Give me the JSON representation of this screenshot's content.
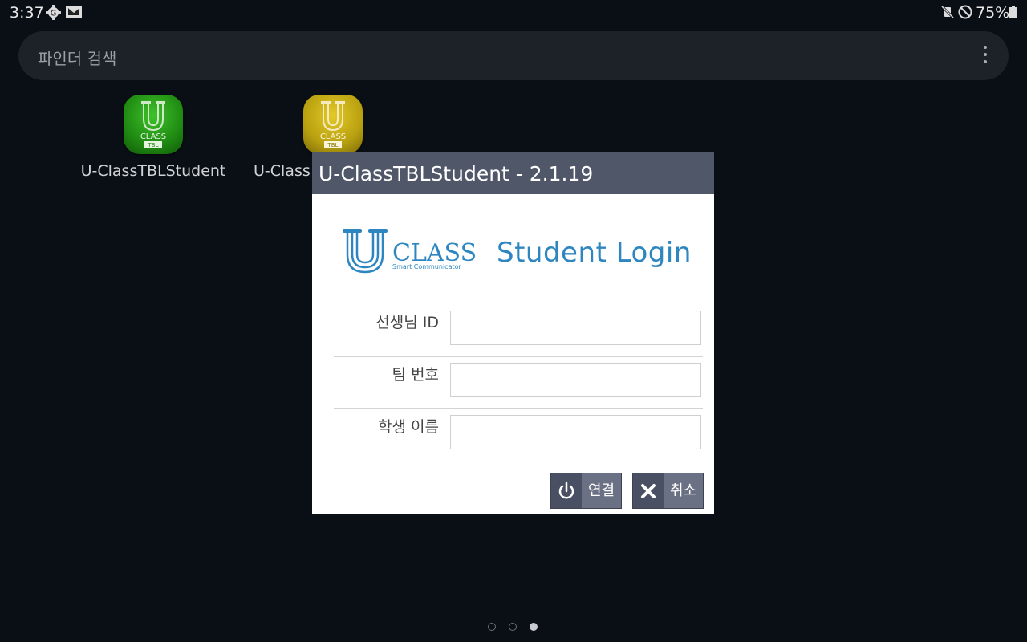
{
  "status_bar": {
    "time": "3:37",
    "battery": "75%",
    "icons": [
      "settings-gear-icon",
      "gmail-icon",
      "mute-vibrate-icon",
      "do-not-disturb-icon",
      "battery-icon"
    ]
  },
  "search": {
    "placeholder": "파인더 검색",
    "menu_icon": "more-vertical-icon"
  },
  "apps": [
    {
      "label": "U-ClassTBLStudent",
      "icon": "uclass-tbl-green-icon",
      "color": "#1f8a12"
    },
    {
      "label": "U-Class",
      "icon": "uclass-tbl-yellow-icon",
      "color": "#b8a010"
    }
  ],
  "dialog": {
    "title": "U-ClassTBLStudent - 2.1.19",
    "logo": {
      "brand": "CLASS",
      "tagline": "Smart Communicator",
      "heading": "Student Login"
    },
    "fields": [
      {
        "label": "선생님 ID",
        "value": ""
      },
      {
        "label": "팀 번호",
        "value": ""
      },
      {
        "label": "학생 이름",
        "value": ""
      }
    ],
    "buttons": {
      "connect": {
        "label": "연결",
        "icon": "power-icon"
      },
      "cancel": {
        "label": "취소",
        "icon": "close-x-icon"
      }
    }
  },
  "page_indicator": {
    "count": 3,
    "active_index": 2
  },
  "colors": {
    "background": "#0a0f15",
    "dialog_title_bar": "#505769",
    "button_bg": "#6b7184",
    "logo_blue": "#2e86c1"
  }
}
